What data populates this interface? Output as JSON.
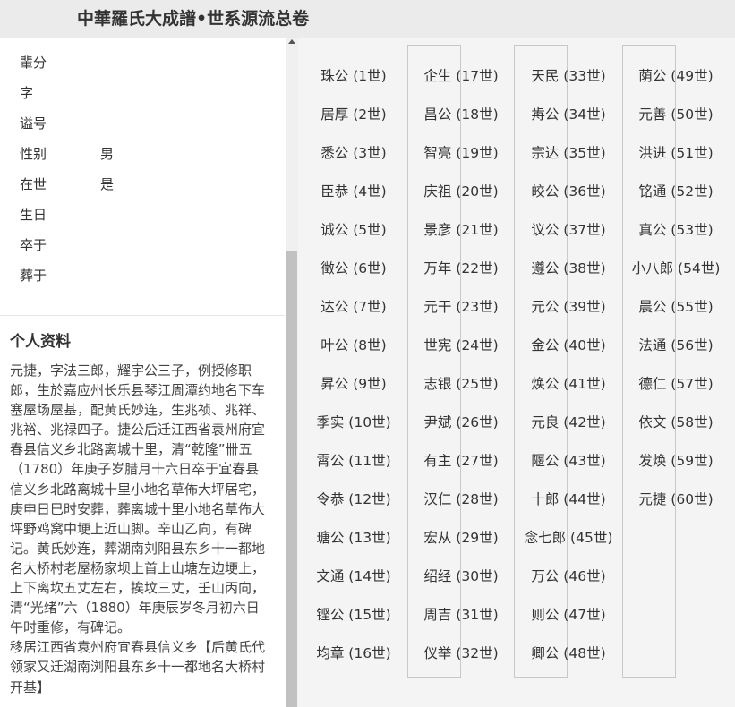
{
  "header": {
    "title": "中華羅氏大成譜•世系源流总卷"
  },
  "person": {
    "fields": [
      {
        "label": "輩分",
        "value": ""
      },
      {
        "label": "字",
        "value": ""
      },
      {
        "label": "谥号",
        "value": ""
      },
      {
        "label": "性别",
        "value": "男"
      },
      {
        "label": "在世",
        "value": "是"
      },
      {
        "label": "生日",
        "value": ""
      },
      {
        "label": "卒于",
        "value": ""
      },
      {
        "label": "葬于",
        "value": ""
      }
    ],
    "section_title": "个人资料",
    "bio": [
      "元捷，字法三郎，耀宇公三子，例授修职郎，生於嘉应州长乐县琴江周潭约地名下车塞屋场屋基，配黄氏妙连，生兆祯、兆祥、兆裕、兆禄四子。捷公后迁江西省袁州府宜春县信义乡北路离城十里，清“乾隆”卌五（1780）年庚子岁腊月十六日卒于宜春县信义乡北路离城十里小地名草佈大坪居宅，庚申日巳时安葬，葬离城十里小地名草佈大坪野鸡窝中埂上近山脚。辛山乙向，有碑记。黄氏妙连，葬湖南刘阳县东乡十一都地名大桥村老屋杨家坝上首上山塘左边埂上，上下离坎五丈左右，挨坟三丈，壬山丙向，清“光绪”六（1880）年庚辰岁冬月初六日午时重修，有碑记。",
      "移居江西省袁州府宜春县信义乡【后黄氏代领家又迁湖南浏阳县东乡十一都地名大桥村开基】"
    ]
  },
  "lineage": [
    "珠公 (1世)",
    "居厚 (2世)",
    "悉公 (3世)",
    "臣恭 (4世)",
    "诚公 (5世)",
    "徵公 (6世)",
    "达公 (7世)",
    "叶公 (8世)",
    "昇公 (9世)",
    "季实 (10世)",
    "霄公 (11世)",
    "令恭 (12世)",
    "瑭公 (13世)",
    "文通 (14世)",
    "铿公 (15世)",
    "均章 (16世)",
    "企生 (17世)",
    "昌公 (18世)",
    "智亮 (19世)",
    "庆祖 (20世)",
    "景彦 (21世)",
    "万年 (22世)",
    "元干 (23世)",
    "世宪 (24世)",
    "志银 (25世)",
    "尹斌 (26世)",
    "有主 (27世)",
    "汉仁 (28世)",
    "宏从 (29世)",
    "绍经 (30世)",
    "周吉 (31世)",
    "仪举 (32世)",
    "天民 (33世)",
    "歬公 (34世)",
    "宗达 (35世)",
    "皎公 (36世)",
    "议公 (37世)",
    "遵公 (38世)",
    "元公 (39世)",
    "金公 (40世)",
    "焕公 (41世)",
    "元良 (42世)",
    "隁公 (43世)",
    "十郎 (44世)",
    "念七郎 (45世)",
    "万公 (46世)",
    "则公 (47世)",
    "卿公 (48世)",
    "荫公 (49世)",
    "元善 (50世)",
    "洪进 (51世)",
    "铭通 (52世)",
    "真公 (53世)",
    "小八郎 (54世)",
    "晨公 (55世)",
    "法通 (56世)",
    "德仁 (57世)",
    "依文 (58世)",
    "发焕 (59世)",
    "元捷 (60世)"
  ]
}
